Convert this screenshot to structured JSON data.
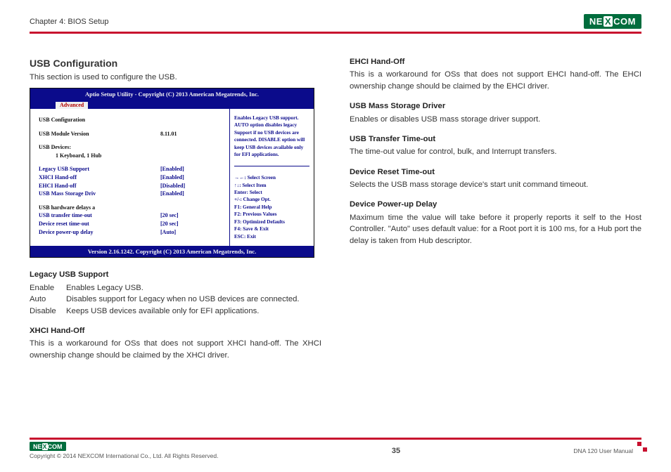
{
  "header": {
    "chapter": "Chapter 4: BIOS Setup",
    "brand": "NEXCOM"
  },
  "left": {
    "title": "USB Configuration",
    "desc": "This section is used to configure the USB.",
    "bios": {
      "header": "Aptio Setup Utility - Copyright (C) 2013 American Megatrends, Inc.",
      "tab": "Advanced",
      "title": "USB Configuration",
      "module_label": "USB Module Version",
      "module_value": "8.11.01",
      "devices_label": "USB Devices:",
      "devices_value": "1 Keyboard, 1 Hub",
      "rows": [
        {
          "label": "Legacy USB Support",
          "value": "[Enabled]"
        },
        {
          "label": "XHCI Hand-off",
          "value": "[Enabled]"
        },
        {
          "label": "EHCI Hand-off",
          "value": "[Disabled]"
        },
        {
          "label": "USB Mass Storage Driv",
          "value": "[Enabled]"
        }
      ],
      "delay_header": "USB hardware delays a",
      "delay_rows": [
        {
          "label": "USB transfer time-out",
          "value": "[20 sec]"
        },
        {
          "label": "Device reset time-out",
          "value": "[20 sec]"
        },
        {
          "label": "Device power-up delay",
          "value": "[Auto]"
        }
      ],
      "help": "Enables Legacy USB support. AUTO option disables legacy Support if no USB devices are connected. DISABLE option will keep USB devices available only for EFI applications.",
      "hints": [
        "→←: Select Screen",
        "↑↓: Select Item",
        "Enter: Select",
        "+/-: Change Opt.",
        "F1: General Help",
        "F2: Previous Values",
        "F3: Optimized Defaults",
        "F4: Save & Exit",
        "ESC: Exit"
      ],
      "footer": "Version 2.16.1242. Copyright (C) 2013 American Megatrends, Inc."
    },
    "legacy": {
      "title": "Legacy USB Support",
      "rows": [
        {
          "key": "Enable",
          "val": "Enables Legacy USB."
        },
        {
          "key": "Auto",
          "val": "Disables support for Legacy when no USB devices are connected."
        },
        {
          "key": "Disable",
          "val": "Keeps USB devices available only for EFI applications."
        }
      ]
    },
    "xhci": {
      "title": "XHCI Hand-Off",
      "body": "This is a workaround for OSs that does not support XHCI hand-off. The XHCI ownership change should be claimed by the XHCI driver."
    }
  },
  "right": {
    "ehci": {
      "title": "EHCI Hand-Off",
      "body": "This is a workaround for OSs that does not support EHCI hand-off. The EHCI ownership change should be claimed by the EHCI driver."
    },
    "mass": {
      "title": "USB Mass Storage Driver",
      "body": "Enables or disables USB mass storage driver support."
    },
    "transfer": {
      "title": "USB Transfer Time-out",
      "body": "The time-out value for control, bulk, and Interrupt transfers."
    },
    "reset": {
      "title": "Device Reset Time-out",
      "body": "Selects the USB mass storage device's start unit command timeout."
    },
    "power": {
      "title": "Device Power-up Delay",
      "body": "Maximum time the value will take before it properly reports it self to the Host Controller. \"Auto\" uses default value: for a Root port it is 100 ms, for a Hub port the delay is taken from Hub descriptor."
    }
  },
  "footer": {
    "copyright": "Copyright © 2014 NEXCOM International Co., Ltd. All Rights Reserved.",
    "page": "35",
    "doc": "DNA 120 User Manual"
  }
}
